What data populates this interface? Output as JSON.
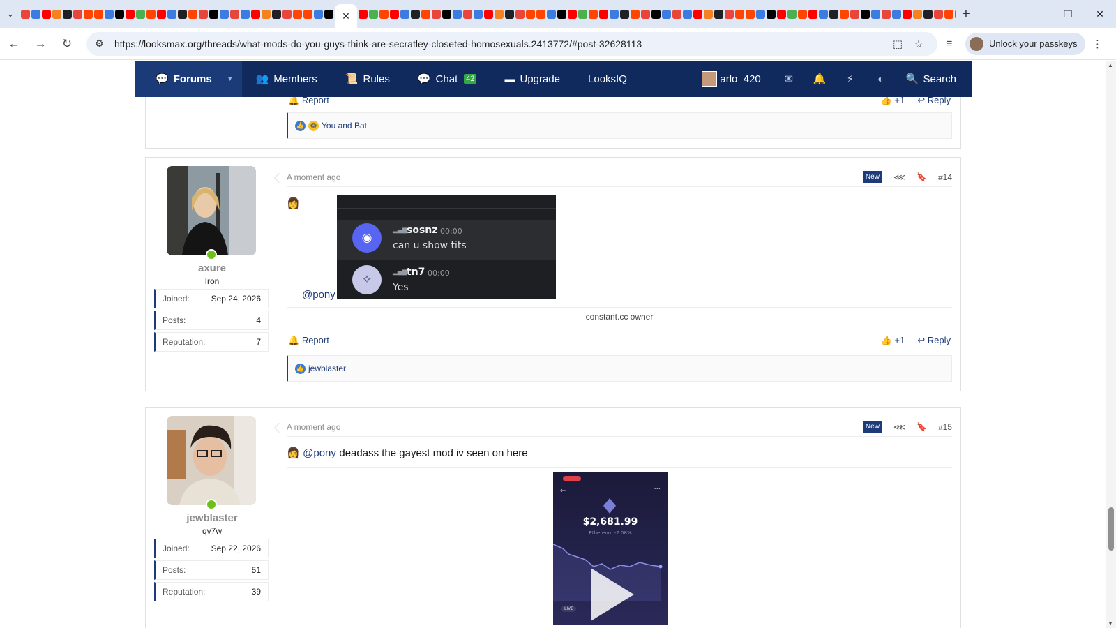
{
  "browser": {
    "url": "https://looksmax.org/threads/what-mods-do-you-guys-think-are-secratley-closeted-homosexuals.2413772/#post-32628113",
    "passkey_label": "Unlock your passkeys",
    "favicon_colors": [
      "#e8463a",
      "#3c7be0",
      "#ff0000",
      "#f58220",
      "#202124",
      "#e8463a",
      "#ff4500",
      "#ff4500",
      "#3c7be0",
      "#000000",
      "#ff0000",
      "#4caf50",
      "#ff4500",
      "#ff0000",
      "#3c7be0",
      "#202124",
      "#ff4500",
      "#e8463a",
      "#000000",
      "#3c7be0"
    ]
  },
  "nav": {
    "forums": "Forums",
    "members": "Members",
    "rules": "Rules",
    "chat": "Chat",
    "chat_count": "42",
    "upgrade": "Upgrade",
    "looksiq": "LooksIQ",
    "username": "arlo_420",
    "search": "Search"
  },
  "post13": {
    "report": "Report",
    "votes": "+1",
    "reply": "Reply",
    "reactions": "You and Bat"
  },
  "post14": {
    "time": "A moment ago",
    "new": "New",
    "number": "#14",
    "mention": "@pony",
    "username": "axure",
    "usertitle": "Iron",
    "joined_label": "Joined:",
    "joined": "Sep 24, 2026",
    "posts_label": "Posts:",
    "posts": "4",
    "rep_label": "Reputation:",
    "rep": "7",
    "signature": "constant.cc owner",
    "report": "Report",
    "votes": "+1",
    "reply": "Reply",
    "reactions": "jewblaster",
    "discord": {
      "name1": "sosnz",
      "time1": "00:00",
      "msg1": "can u show tits",
      "name2": "tn7",
      "time2": "00:00",
      "msg2": "Yes"
    }
  },
  "post15": {
    "time": "A moment ago",
    "new": "New",
    "number": "#15",
    "mention": "@pony",
    "text": "deadass the gayest mod iv seen on here",
    "username": "jewblaster",
    "usertitle": "qv7w",
    "joined_label": "Joined:",
    "joined": "Sep 22, 2026",
    "posts_label": "Posts:",
    "posts": "51",
    "rep_label": "Reputation:",
    "rep": "39",
    "video": {
      "price": "$2,681.99",
      "sub": "Ethereum -2.08%",
      "live": "LIVE"
    }
  }
}
